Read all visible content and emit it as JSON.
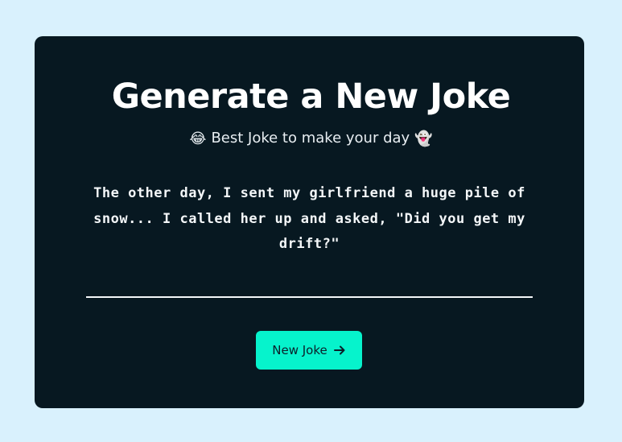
{
  "header": {
    "title": "Generate a New Joke",
    "subtitle": "Best Joke to make your day",
    "subtitle_emoji_left": "😂",
    "subtitle_emoji_right": "👻"
  },
  "joke": {
    "text": "The other day, I sent my girlfriend a huge pile of snow... I called her up and asked, \"Did you get my drift?\""
  },
  "actions": {
    "new_joke_label": "New Joke",
    "new_joke_icon": "arrow-right-icon"
  },
  "colors": {
    "page_background": "#d9f1fd",
    "card_background": "#071821",
    "accent": "#06f3cc",
    "text_primary": "#ffffff"
  }
}
